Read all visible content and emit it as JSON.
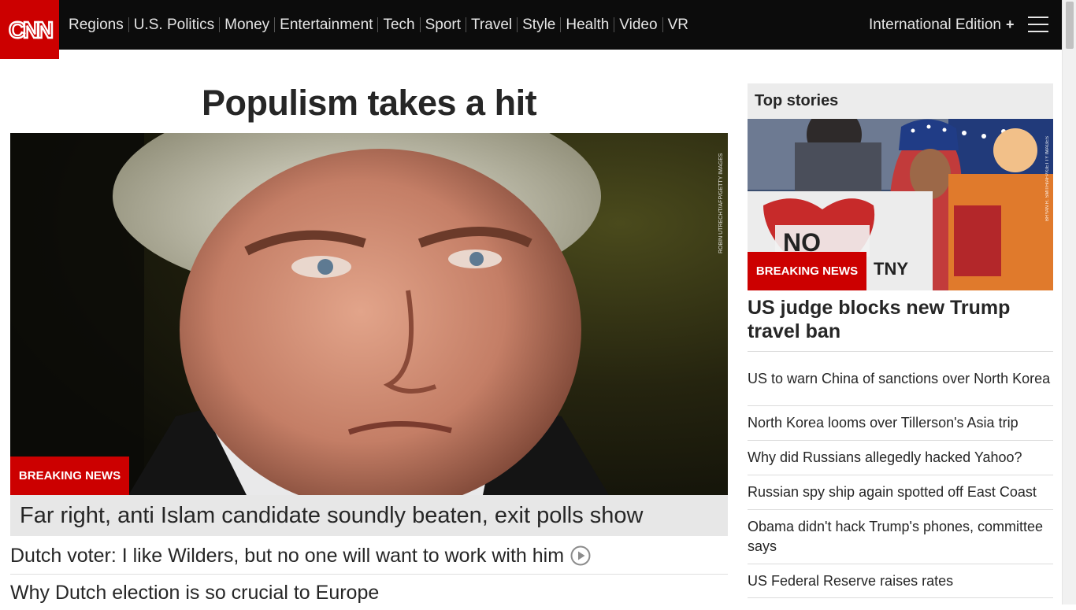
{
  "header": {
    "logo_text": "CNN",
    "nav": [
      "Regions",
      "U.S. Politics",
      "Money",
      "Entertainment",
      "Tech",
      "Sport",
      "Travel",
      "Style",
      "Health",
      "Video",
      "VR"
    ],
    "edition": "International Edition",
    "edition_icon": "plus-icon",
    "menu_icon": "hamburger-menu-icon"
  },
  "main": {
    "headline": "Populism takes a hit",
    "hero_credit": "ROBIN UTRECHT/AFP/GETTY IMAGES",
    "badge": "BREAKING NEWS",
    "caption": "Far right, anti Islam candidate soundly beaten, exit polls show",
    "related": [
      {
        "text": "Dutch voter: I like Wilders, but no one will want to work with him",
        "icon": "play-video-icon"
      },
      {
        "text": "Why Dutch election is so crucial to Europe"
      }
    ]
  },
  "rail": {
    "header": "Top stories",
    "image_credit": "BRYAN R. SMITH/AFP/GETTY IMAGES",
    "badge": "BREAKING NEWS",
    "image_signs": [
      "NO",
      "TNY"
    ],
    "headline": "US judge blocks new Trump travel ban",
    "stories": [
      "US to warn China of sanctions over North Korea",
      "North Korea looms over Tillerson's Asia trip",
      "Why did Russians allegedly hacked Yahoo?",
      "Russian spy ship again spotted off East Coast",
      "Obama didn't hack Trump's phones, committee says",
      "US Federal Reserve raises rates"
    ]
  },
  "colors": {
    "brand_red": "#cc0000",
    "header_bg": "#0c0c0c",
    "caption_bg": "#e7e7e7",
    "rail_header_bg": "#ececec"
  }
}
